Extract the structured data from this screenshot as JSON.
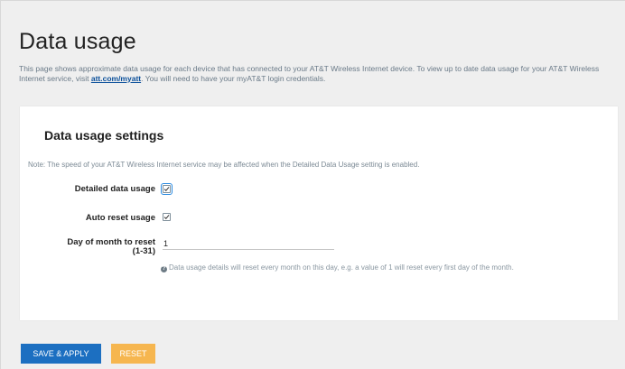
{
  "page": {
    "title": "Data usage",
    "intro_text": "This page shows approximate data usage for each device that has connected to your AT&T Wireless Internet device. To view up to date data usage for your AT&T Wireless Internet service, visit ",
    "intro_link": "att.com/myatt",
    "intro_text_after": ". You will need to have your myAT&T login credentials."
  },
  "settings": {
    "title": "Data usage settings",
    "note": "Note: The speed of your AT&T Wireless Internet service may be affected when the Detailed Data Usage setting is enabled.",
    "detailed_label": "Detailed data usage",
    "detailed_checked": true,
    "auto_reset_label": "Auto reset usage",
    "auto_reset_checked": true,
    "day_label_line1": "Day of month to reset",
    "day_label_line2": "(1-31)",
    "day_value": "1",
    "day_help": "Data usage details will reset every month on this day, e.g. a value of 1 will reset every first day of the month.",
    "help_icon": "question-circle-icon"
  },
  "actions": {
    "save_label": "SAVE & APPLY",
    "reset_label": "RESET"
  },
  "colors": {
    "primary": "#1c6fc1",
    "secondary": "#f6b64f",
    "link": "#0a4f9a"
  }
}
